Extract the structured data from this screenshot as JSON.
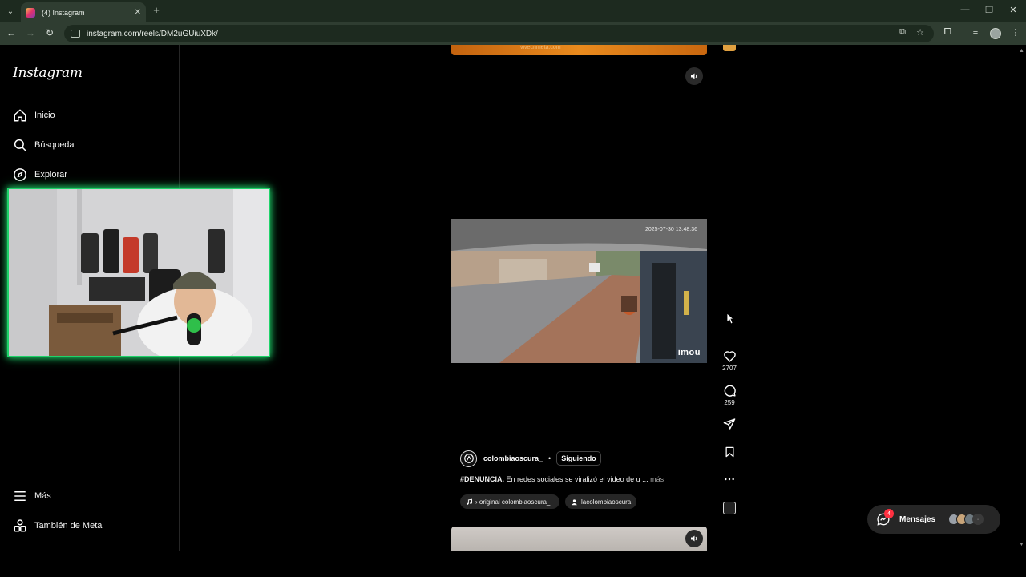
{
  "browser": {
    "tab_title": "(4) Instagram",
    "url": "instagram.com/reels/DM2uGUiuXDk/"
  },
  "sidebar": {
    "logo": "Instagram",
    "items": [
      {
        "label": "Inicio",
        "icon": "home-icon"
      },
      {
        "label": "Búsqueda",
        "icon": "search-icon"
      },
      {
        "label": "Explorar",
        "icon": "compass-icon"
      }
    ],
    "bottom_items": [
      {
        "label": "Más",
        "icon": "menu-icon"
      },
      {
        "label": "También de Meta",
        "icon": "meta-apps-icon"
      }
    ]
  },
  "reel_prev": {
    "banner_text": "vivecnmeta.com"
  },
  "reel": {
    "timestamp": "2025-07-30 13:48:36",
    "camera_brand": "imou",
    "author": "colombiaoscura_",
    "follow_label": "Siguiendo",
    "separator": "•",
    "caption_tag": "#DENUNCIA.",
    "caption_text": " En redes sociales se viralizó el video de u ... ",
    "caption_more": "más",
    "audio_label": "› original  colombiaoscura_ ·",
    "tagged_user": "lacolombiaoscura",
    "likes": "2707",
    "comments": "259"
  },
  "messages": {
    "label": "Mensajes",
    "badge": "4"
  },
  "colors": {
    "webcam_border": "#1fd36a",
    "notification": "#ff3040"
  }
}
